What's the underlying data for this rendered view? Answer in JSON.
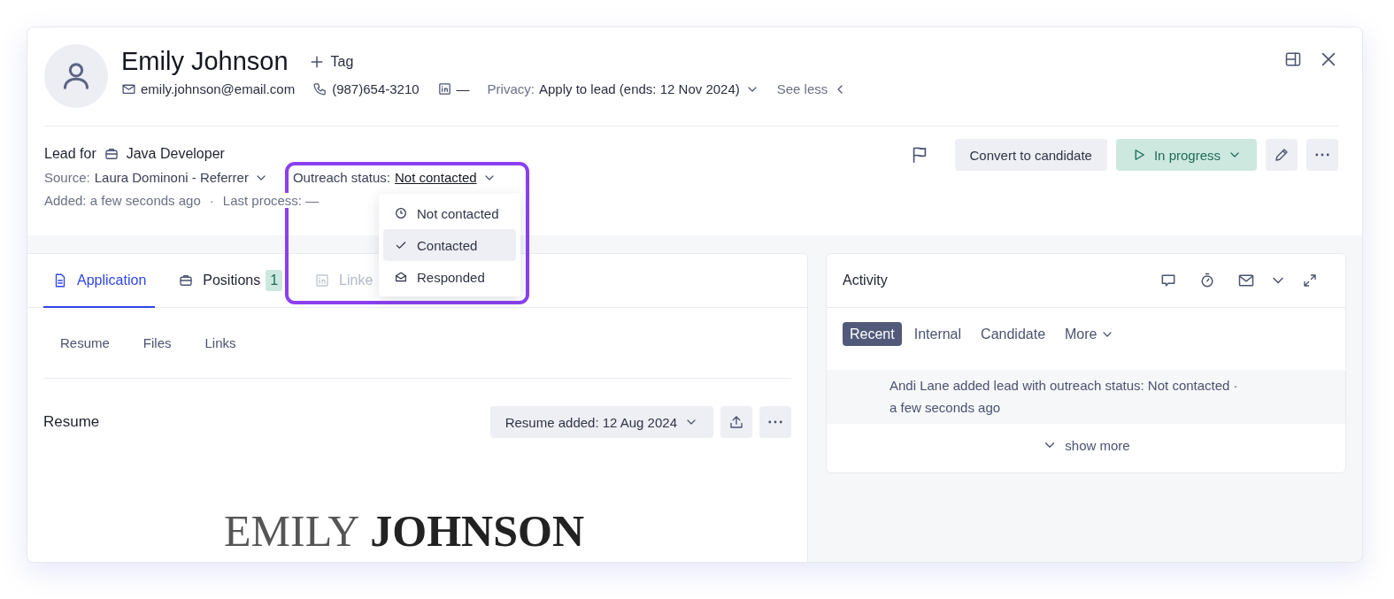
{
  "header": {
    "name": "Emily Johnson",
    "tag_button": "Tag",
    "email": "emily.johnson@email.com",
    "phone": "(987)654-3210",
    "linkedin": "—",
    "privacy_label": "Privacy:",
    "privacy_value": "Apply to lead (ends: 12 Nov 2024)",
    "see_less": "See less"
  },
  "lead": {
    "lead_for": "Lead for",
    "position": "Java Developer",
    "source_label": "Source:",
    "source_value": "Laura Dominoni - Referrer",
    "outreach_label": "Outreach status:",
    "outreach_value": "Not contacted",
    "added": "Added: a few seconds ago",
    "separator": "·",
    "last_process": "Last process: —"
  },
  "outreach_menu": [
    {
      "label": "Not contacted",
      "kind": "clock",
      "selected": false
    },
    {
      "label": "Contacted",
      "kind": "check",
      "selected": true
    },
    {
      "label": "Responded",
      "kind": "envelope",
      "selected": false
    }
  ],
  "actions": {
    "convert": "Convert to candidate",
    "status": "In progress"
  },
  "tabs": [
    {
      "label": "Application",
      "kind": "document",
      "selected": true,
      "disabled": false
    },
    {
      "label": "Positions",
      "kind": "briefcase",
      "badge": "1",
      "selected": false,
      "disabled": false
    },
    {
      "label": "Linke",
      "kind": "linkedin",
      "selected": false,
      "disabled": true
    }
  ],
  "subtabs": [
    "Resume",
    "Files",
    "Links"
  ],
  "resume": {
    "title": "Resume",
    "added_button": "Resume added: 12 Aug 2024",
    "doc_first": "EMILY",
    "doc_last": "JOHNSON"
  },
  "activity": {
    "title": "Activity",
    "filters": [
      {
        "label": "Recent",
        "selected": true,
        "has_menu": false
      },
      {
        "label": "Internal",
        "selected": false,
        "has_menu": false
      },
      {
        "label": "Candidate",
        "selected": false,
        "has_menu": false
      },
      {
        "label": "More",
        "selected": false,
        "has_menu": true
      }
    ],
    "entries": [
      {
        "text": "Andi Lane added lead with outreach status: Not contacted ·",
        "time": "a few seconds ago"
      }
    ],
    "show_more": "show more"
  }
}
